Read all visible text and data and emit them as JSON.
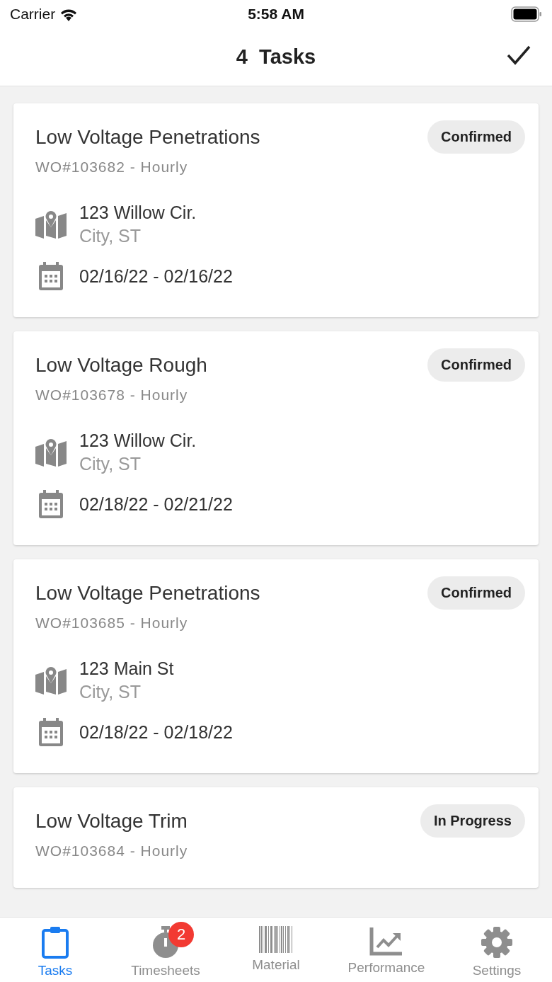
{
  "status_bar": {
    "carrier": "Carrier",
    "time": "5:58 AM"
  },
  "header": {
    "title": "4  Tasks"
  },
  "tasks": [
    {
      "title": "Low Voltage Penetrations",
      "work_order": "WO#103682 - Hourly",
      "status": "Confirmed",
      "address": "123 Willow Cir.",
      "city": "City, ST",
      "dates": "02/16/22 - 02/16/22"
    },
    {
      "title": "Low Voltage Rough",
      "work_order": "WO#103678 - Hourly",
      "status": "Confirmed",
      "address": "123 Willow Cir.",
      "city": "City, ST",
      "dates": "02/18/22 - 02/21/22"
    },
    {
      "title": "Low Voltage Penetrations",
      "work_order": "WO#103685 - Hourly",
      "status": "Confirmed",
      "address": "123 Main St",
      "city": "City, ST",
      "dates": "02/18/22 - 02/18/22"
    },
    {
      "title": "Low Voltage Trim",
      "work_order": "WO#103684 - Hourly",
      "status": "In Progress"
    }
  ],
  "tab_bar": [
    {
      "kind": "tasks",
      "label": "Tasks",
      "selected": true
    },
    {
      "kind": "timesheets",
      "label": "Timesheets",
      "selected": false,
      "badge": "2"
    },
    {
      "kind": "material",
      "label": "Material",
      "selected": false
    },
    {
      "kind": "performance",
      "label": "Performance",
      "selected": false
    },
    {
      "kind": "settings",
      "label": "Settings",
      "selected": false
    }
  ]
}
